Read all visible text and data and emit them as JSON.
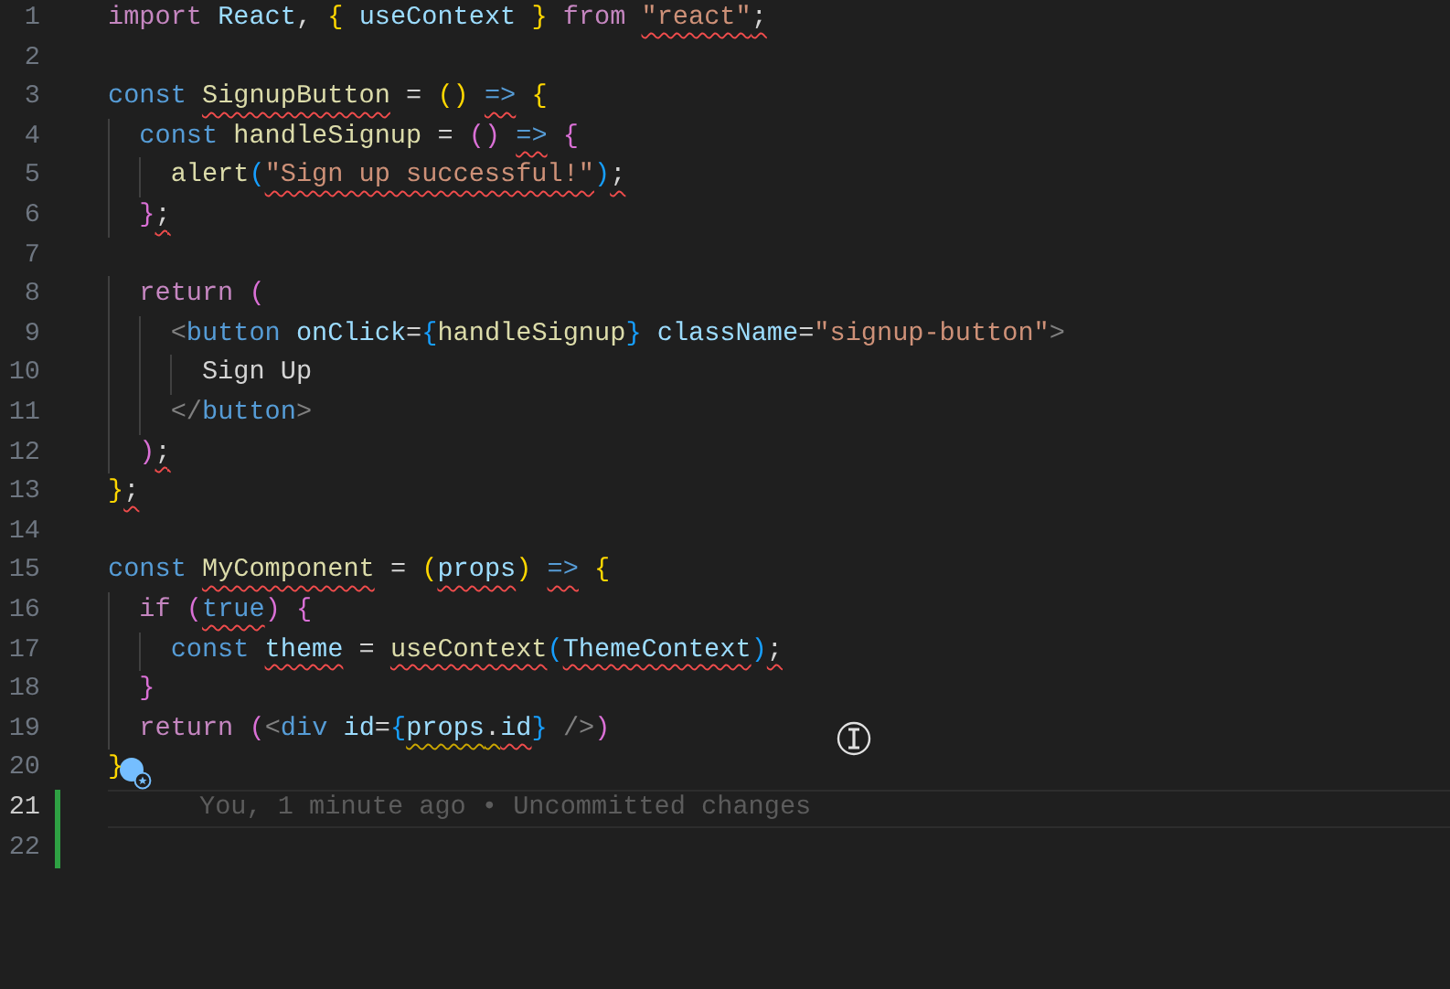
{
  "editor": {
    "lines": [
      {
        "number": "1",
        "current": false,
        "tokens": [
          {
            "t": "import ",
            "kind": "kw"
          },
          {
            "t": "React",
            "kind": "var"
          },
          {
            "t": ", ",
            "kind": "pl"
          },
          {
            "t": "{ ",
            "kind": "b1"
          },
          {
            "t": "useContext ",
            "kind": "var"
          },
          {
            "t": "} ",
            "kind": "b1"
          },
          {
            "t": "from ",
            "kind": "kw"
          },
          {
            "t": "\"react\"",
            "kind": "str",
            "error": true
          },
          {
            "t": ";",
            "kind": "pl",
            "error": true
          }
        ]
      },
      {
        "number": "2",
        "current": false
      },
      {
        "number": "3",
        "current": false,
        "tokens": [
          {
            "t": "const ",
            "kind": "st"
          },
          {
            "t": "SignupButton",
            "kind": "fn",
            "error": true
          },
          {
            "t": " = ",
            "kind": "pl"
          },
          {
            "t": "(",
            "kind": "b1"
          },
          {
            "t": ") ",
            "kind": "b1"
          },
          {
            "t": "=>",
            "kind": "st",
            "error": true
          },
          {
            "t": " {",
            "kind": "b1"
          }
        ]
      },
      {
        "number": "4",
        "current": false,
        "tokens": [
          {
            "t": "  const ",
            "kind": "st"
          },
          {
            "t": "handleSignup",
            "kind": "fn"
          },
          {
            "t": " = ",
            "kind": "pl"
          },
          {
            "t": "(",
            "kind": "b2"
          },
          {
            "t": ") ",
            "kind": "b2"
          },
          {
            "t": "=>",
            "kind": "st",
            "error": true
          },
          {
            "t": " {",
            "kind": "b2"
          }
        ]
      },
      {
        "number": "5",
        "current": false,
        "tokens": [
          {
            "t": "    alert",
            "kind": "fn"
          },
          {
            "t": "(",
            "kind": "b3"
          },
          {
            "t": "\"Sign up successful!\"",
            "kind": "str",
            "error": true
          },
          {
            "t": ")",
            "kind": "b3"
          },
          {
            "t": ";",
            "kind": "pl",
            "error": true
          }
        ]
      },
      {
        "number": "6",
        "current": false,
        "tokens": [
          {
            "t": "  }",
            "kind": "b2"
          },
          {
            "t": ";",
            "kind": "pl",
            "error": true
          }
        ]
      },
      {
        "number": "7",
        "current": false
      },
      {
        "number": "8",
        "current": false,
        "tokens": [
          {
            "t": "  return ",
            "kind": "kw"
          },
          {
            "t": "(",
            "kind": "b2"
          }
        ]
      },
      {
        "number": "9",
        "current": false,
        "tokens": [
          {
            "t": "    <",
            "kind": "tag"
          },
          {
            "t": "button ",
            "kind": "st"
          },
          {
            "t": "onClick",
            "kind": "var"
          },
          {
            "t": "=",
            "kind": "pl"
          },
          {
            "t": "{",
            "kind": "b3"
          },
          {
            "t": "handleSignup",
            "kind": "fn"
          },
          {
            "t": "} ",
            "kind": "b3"
          },
          {
            "t": "className",
            "kind": "var"
          },
          {
            "t": "=",
            "kind": "pl"
          },
          {
            "t": "\"signup-button\"",
            "kind": "str"
          },
          {
            "t": ">",
            "kind": "tag"
          }
        ]
      },
      {
        "number": "10",
        "current": false,
        "tokens": [
          {
            "t": "      Sign Up",
            "kind": "pl"
          }
        ]
      },
      {
        "number": "11",
        "current": false,
        "tokens": [
          {
            "t": "    </",
            "kind": "tag"
          },
          {
            "t": "button",
            "kind": "st"
          },
          {
            "t": ">",
            "kind": "tag"
          }
        ]
      },
      {
        "number": "12",
        "current": false,
        "tokens": [
          {
            "t": "  )",
            "kind": "b2"
          },
          {
            "t": ";",
            "kind": "pl",
            "error": true
          }
        ]
      },
      {
        "number": "13",
        "current": false,
        "tokens": [
          {
            "t": "}",
            "kind": "b1"
          },
          {
            "t": ";",
            "kind": "pl",
            "error": true
          }
        ]
      },
      {
        "number": "14",
        "current": false
      },
      {
        "number": "15",
        "current": false,
        "tokens": [
          {
            "t": "const ",
            "kind": "st"
          },
          {
            "t": "MyComponent",
            "kind": "fn",
            "error": true
          },
          {
            "t": " = ",
            "kind": "pl"
          },
          {
            "t": "(",
            "kind": "b1"
          },
          {
            "t": "props",
            "kind": "var",
            "error": true
          },
          {
            "t": ") ",
            "kind": "b1"
          },
          {
            "t": "=>",
            "kind": "st",
            "error": true
          },
          {
            "t": " {",
            "kind": "b1"
          }
        ]
      },
      {
        "number": "16",
        "current": false,
        "tokens": [
          {
            "t": "  if ",
            "kind": "kw"
          },
          {
            "t": "(",
            "kind": "b2"
          },
          {
            "t": "true",
            "kind": "st",
            "error": true
          },
          {
            "t": ") {",
            "kind": "b2"
          }
        ]
      },
      {
        "number": "17",
        "current": false,
        "tokens": [
          {
            "t": "    const ",
            "kind": "st"
          },
          {
            "t": "theme",
            "kind": "var",
            "error": true
          },
          {
            "t": " = ",
            "kind": "pl"
          },
          {
            "t": "useContext",
            "kind": "fn",
            "error": true
          },
          {
            "t": "(",
            "kind": "b3"
          },
          {
            "t": "ThemeContext",
            "kind": "var",
            "error": true
          },
          {
            "t": ")",
            "kind": "b3"
          },
          {
            "t": ";",
            "kind": "pl",
            "error": true
          }
        ]
      },
      {
        "number": "18",
        "current": false,
        "tokens": [
          {
            "t": "  }",
            "kind": "b2"
          }
        ]
      },
      {
        "number": "19",
        "current": false,
        "tokens": [
          {
            "t": "  return ",
            "kind": "kw"
          },
          {
            "t": "(",
            "kind": "b2"
          },
          {
            "t": "<",
            "kind": "tag"
          },
          {
            "t": "div ",
            "kind": "st"
          },
          {
            "t": "id",
            "kind": "var"
          },
          {
            "t": "=",
            "kind": "pl"
          },
          {
            "t": "{",
            "kind": "b3"
          },
          {
            "t": "props",
            "kind": "var",
            "warning": true
          },
          {
            "t": ".",
            "kind": "pl",
            "warning": true
          },
          {
            "t": "id",
            "kind": "var",
            "error": true
          },
          {
            "t": "} ",
            "kind": "b3"
          },
          {
            "t": "/>",
            "kind": "tag"
          },
          {
            "t": ")",
            "kind": "b2"
          }
        ]
      },
      {
        "number": "20",
        "current": false,
        "tokens": [
          {
            "t": "}",
            "kind": "b1"
          }
        ],
        "marker": true
      },
      {
        "number": "21",
        "current": true,
        "git_added": true,
        "blame": "You, 1 minute ago • Uncommitted changes"
      },
      {
        "number": "22",
        "current": false,
        "git_added": true
      }
    ]
  }
}
